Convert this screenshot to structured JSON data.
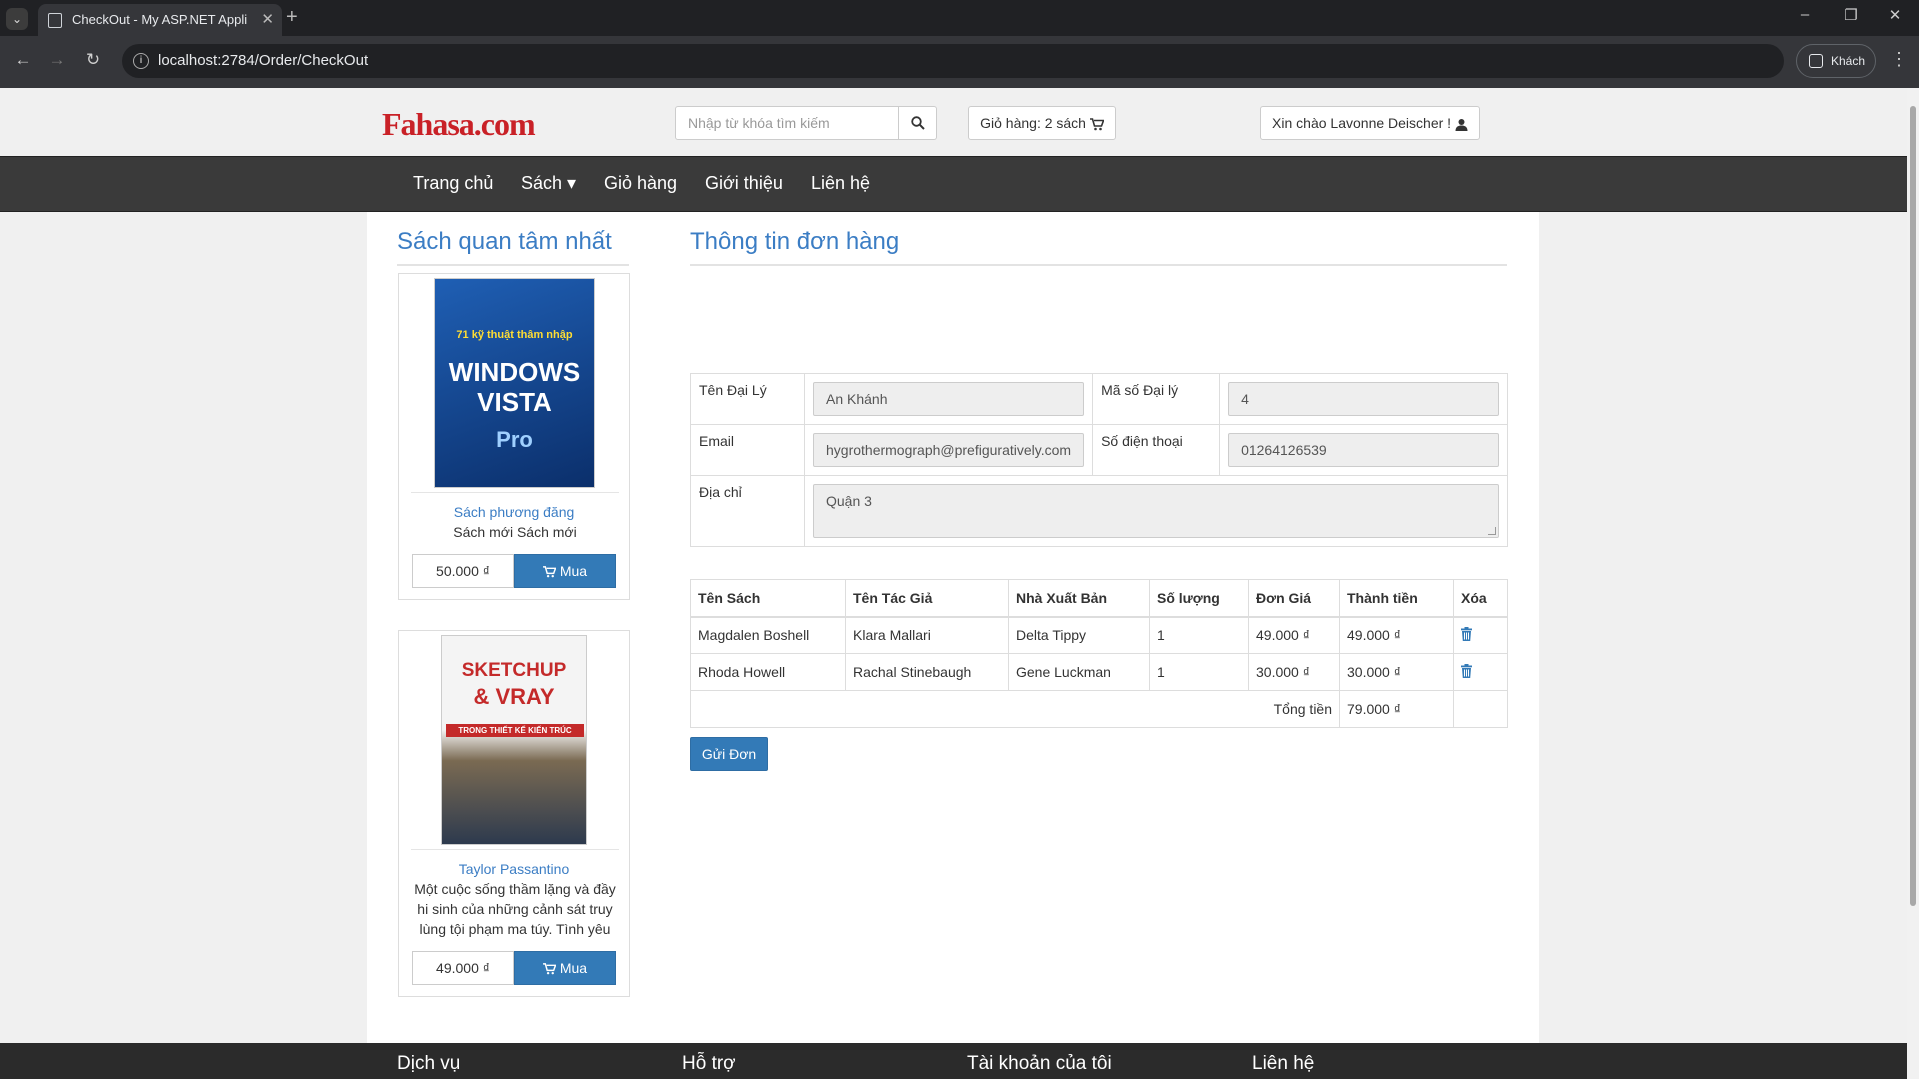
{
  "browser": {
    "tab_title": "CheckOut - My ASP.NET Appli",
    "url": "localhost:2784/Order/CheckOut",
    "profile_label": "Khách",
    "win_minimize": "–",
    "win_restore": "❐",
    "win_close": "✕",
    "tab_close": "✕",
    "new_tab": "+"
  },
  "header": {
    "logo": "Fahasa.com",
    "search_placeholder": "Nhập từ khóa tìm kiếm",
    "cart_label": "Giỏ hàng: 2 sách",
    "user_greeting": "Xin chào Lavonne Deischer !"
  },
  "nav": {
    "items": [
      "Trang chủ",
      "Sách ▾",
      "Giỏ hàng",
      "Giới thiệu",
      "Liên hệ"
    ]
  },
  "sidebar": {
    "title": "Sách quan tâm nhất",
    "books": [
      {
        "cover_top": "71 kỹ thuật thâm nhập",
        "cover_main": "WINDOWS VISTA",
        "cover_sub": "Pro",
        "name": "Sách phương đăng",
        "description": "Sách mới Sách mới",
        "price": "50.000 ₫",
        "buy_label": "Mua",
        "cover_color": "#1d4f9c"
      },
      {
        "cover_top": "SKETCHUP",
        "cover_main": "& VRAY",
        "cover_sub": "TRONG THIẾT KẾ KIẾN TRÚC",
        "name": "Taylor Passantino",
        "description": "Một cuộc sống thầm lặng và đầy hi sinh của những cảnh sát truy lùng tội phạm ma túy. Tình yêu",
        "price": "49.000 ₫",
        "buy_label": "Mua",
        "cover_color": "#c42a2a"
      }
    ]
  },
  "order_info": {
    "title": "Thông tin đơn hàng",
    "agent_name_label": "Tên Đại Lý",
    "agent_name_value": "An Khánh",
    "agent_id_label": "Mã số Đại lý",
    "agent_id_value": "4",
    "email_label": "Email",
    "email_value": "hygrothermograph@prefiguratively.com",
    "phone_label": "Số điện thoại",
    "phone_value": "01264126539",
    "address_label": "Địa chỉ",
    "address_value": "Quận 3"
  },
  "order_table": {
    "headers": [
      "Tên Sách",
      "Tên Tác Giả",
      "Nhà Xuất Bản",
      "Số lượng",
      "Đơn Giá",
      "Thành tiền",
      "Xóa"
    ],
    "rows": [
      [
        "Magdalen Boshell",
        "Klara Mallari",
        "Delta Tippy",
        "1",
        "49.000 ₫",
        "49.000 ₫"
      ],
      [
        "Rhoda Howell",
        "Rachal Stinebaugh",
        "Gene Luckman",
        "1",
        "30.000 ₫",
        "30.000 ₫"
      ]
    ],
    "total_label": "Tổng tiền",
    "total_value": "79.000 ₫"
  },
  "send_button": "Gửi Đơn",
  "footer": {
    "items": [
      "Dịch vụ",
      "Hỗ trợ",
      "Tài khoản của tôi",
      "Liên hệ"
    ]
  }
}
